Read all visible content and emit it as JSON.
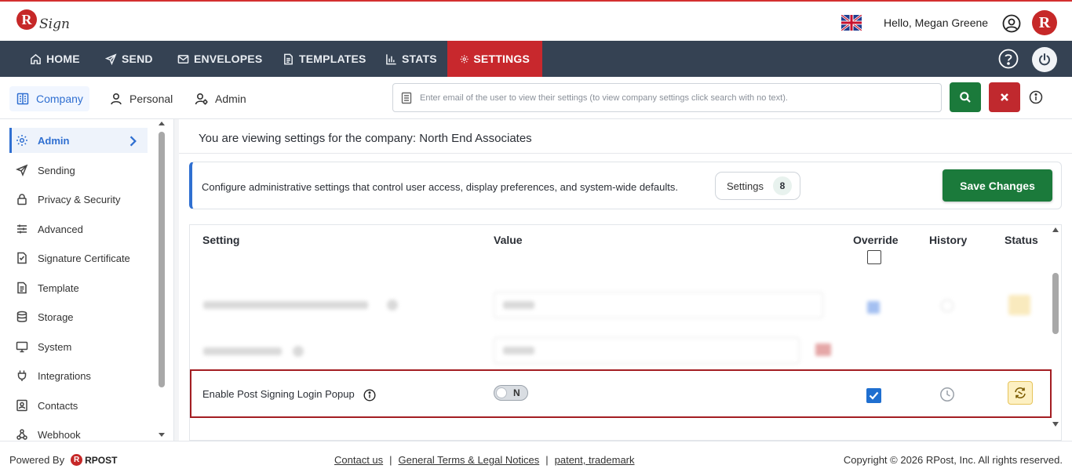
{
  "app": {
    "logo_text": "RSign",
    "greeting": "Hello, Megan Greene",
    "brand_badge": "R"
  },
  "nav": {
    "items": [
      {
        "label": "HOME",
        "icon": "home-icon"
      },
      {
        "label": "SEND",
        "icon": "send-icon"
      },
      {
        "label": "ENVELOPES",
        "icon": "envelope-icon"
      },
      {
        "label": "TEMPLATES",
        "icon": "document-icon"
      },
      {
        "label": "STATS",
        "icon": "bar-chart-icon"
      },
      {
        "label": "SETTINGS",
        "icon": "gear-icon",
        "active": true
      }
    ],
    "active_color": "#c8282d",
    "bar_color": "#354253"
  },
  "subtabs": [
    {
      "label": "Company",
      "active": true
    },
    {
      "label": "Personal"
    },
    {
      "label": "Admin"
    }
  ],
  "search": {
    "placeholder": "Enter email of the user to view their settings (to view company settings click search with no text)."
  },
  "sidebar": {
    "items": [
      {
        "label": "Admin",
        "icon": "gear-icon",
        "active": true
      },
      {
        "label": "Sending",
        "icon": "send-icon"
      },
      {
        "label": "Privacy & Security",
        "icon": "lock-icon"
      },
      {
        "label": "Advanced",
        "icon": "sliders-icon"
      },
      {
        "label": "Signature Certificate",
        "icon": "certificate-icon"
      },
      {
        "label": "Template",
        "icon": "document-icon"
      },
      {
        "label": "Storage",
        "icon": "database-icon"
      },
      {
        "label": "System",
        "icon": "monitor-icon"
      },
      {
        "label": "Integrations",
        "icon": "plug-icon"
      },
      {
        "label": "Contacts",
        "icon": "contact-card-icon"
      },
      {
        "label": "Webhook",
        "icon": "webhook-icon"
      }
    ]
  },
  "main": {
    "viewing_text": "You are viewing settings for the company: North End Associates",
    "notice_text": "Configure administrative settings that control user access, display preferences, and system-wide defaults.",
    "settings_pill_label": "Settings",
    "settings_count": "8",
    "save_label": "Save Changes"
  },
  "table": {
    "headers": {
      "setting": "Setting",
      "value": "Value",
      "override": "Override",
      "history": "History",
      "status": "Status"
    },
    "highlighted_row": {
      "label": "Enable Post Signing Login Popup",
      "toggle_value": "N",
      "override_checked": true
    }
  },
  "footer": {
    "powered_by": "Powered By",
    "rpost_logo": "RPOST",
    "links": [
      "Contact us",
      "General Terms & Legal Notices",
      "patent, trademark"
    ],
    "separator": "|",
    "copyright": "Copyright © 2026 RPost, Inc. All rights reserved."
  }
}
